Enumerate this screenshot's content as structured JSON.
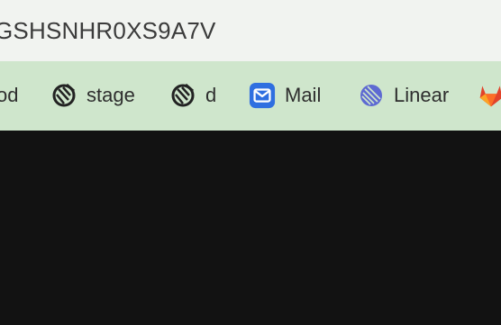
{
  "address_bar": {
    "url_text": "GSHSNHR0XS9A7V"
  },
  "bookmarks": [
    {
      "label": "od",
      "icon": "none"
    },
    {
      "label": "stage",
      "icon": "vendor-logo-icon"
    },
    {
      "label": "d",
      "icon": "vendor-logo-icon"
    },
    {
      "label": "Mail",
      "icon": "mail-icon"
    },
    {
      "label": "Linear",
      "icon": "linear-icon"
    },
    {
      "label": "",
      "icon": "gitlab-icon"
    }
  ],
  "colors": {
    "address_bg": "#f1f3f0",
    "bookmarks_bg": "#cfe6cc",
    "content_bg": "#121212",
    "mail_blue": "#2f6fe0",
    "linear_purple": "#5e6ad2",
    "gitlab_orange": "#e2432a"
  }
}
